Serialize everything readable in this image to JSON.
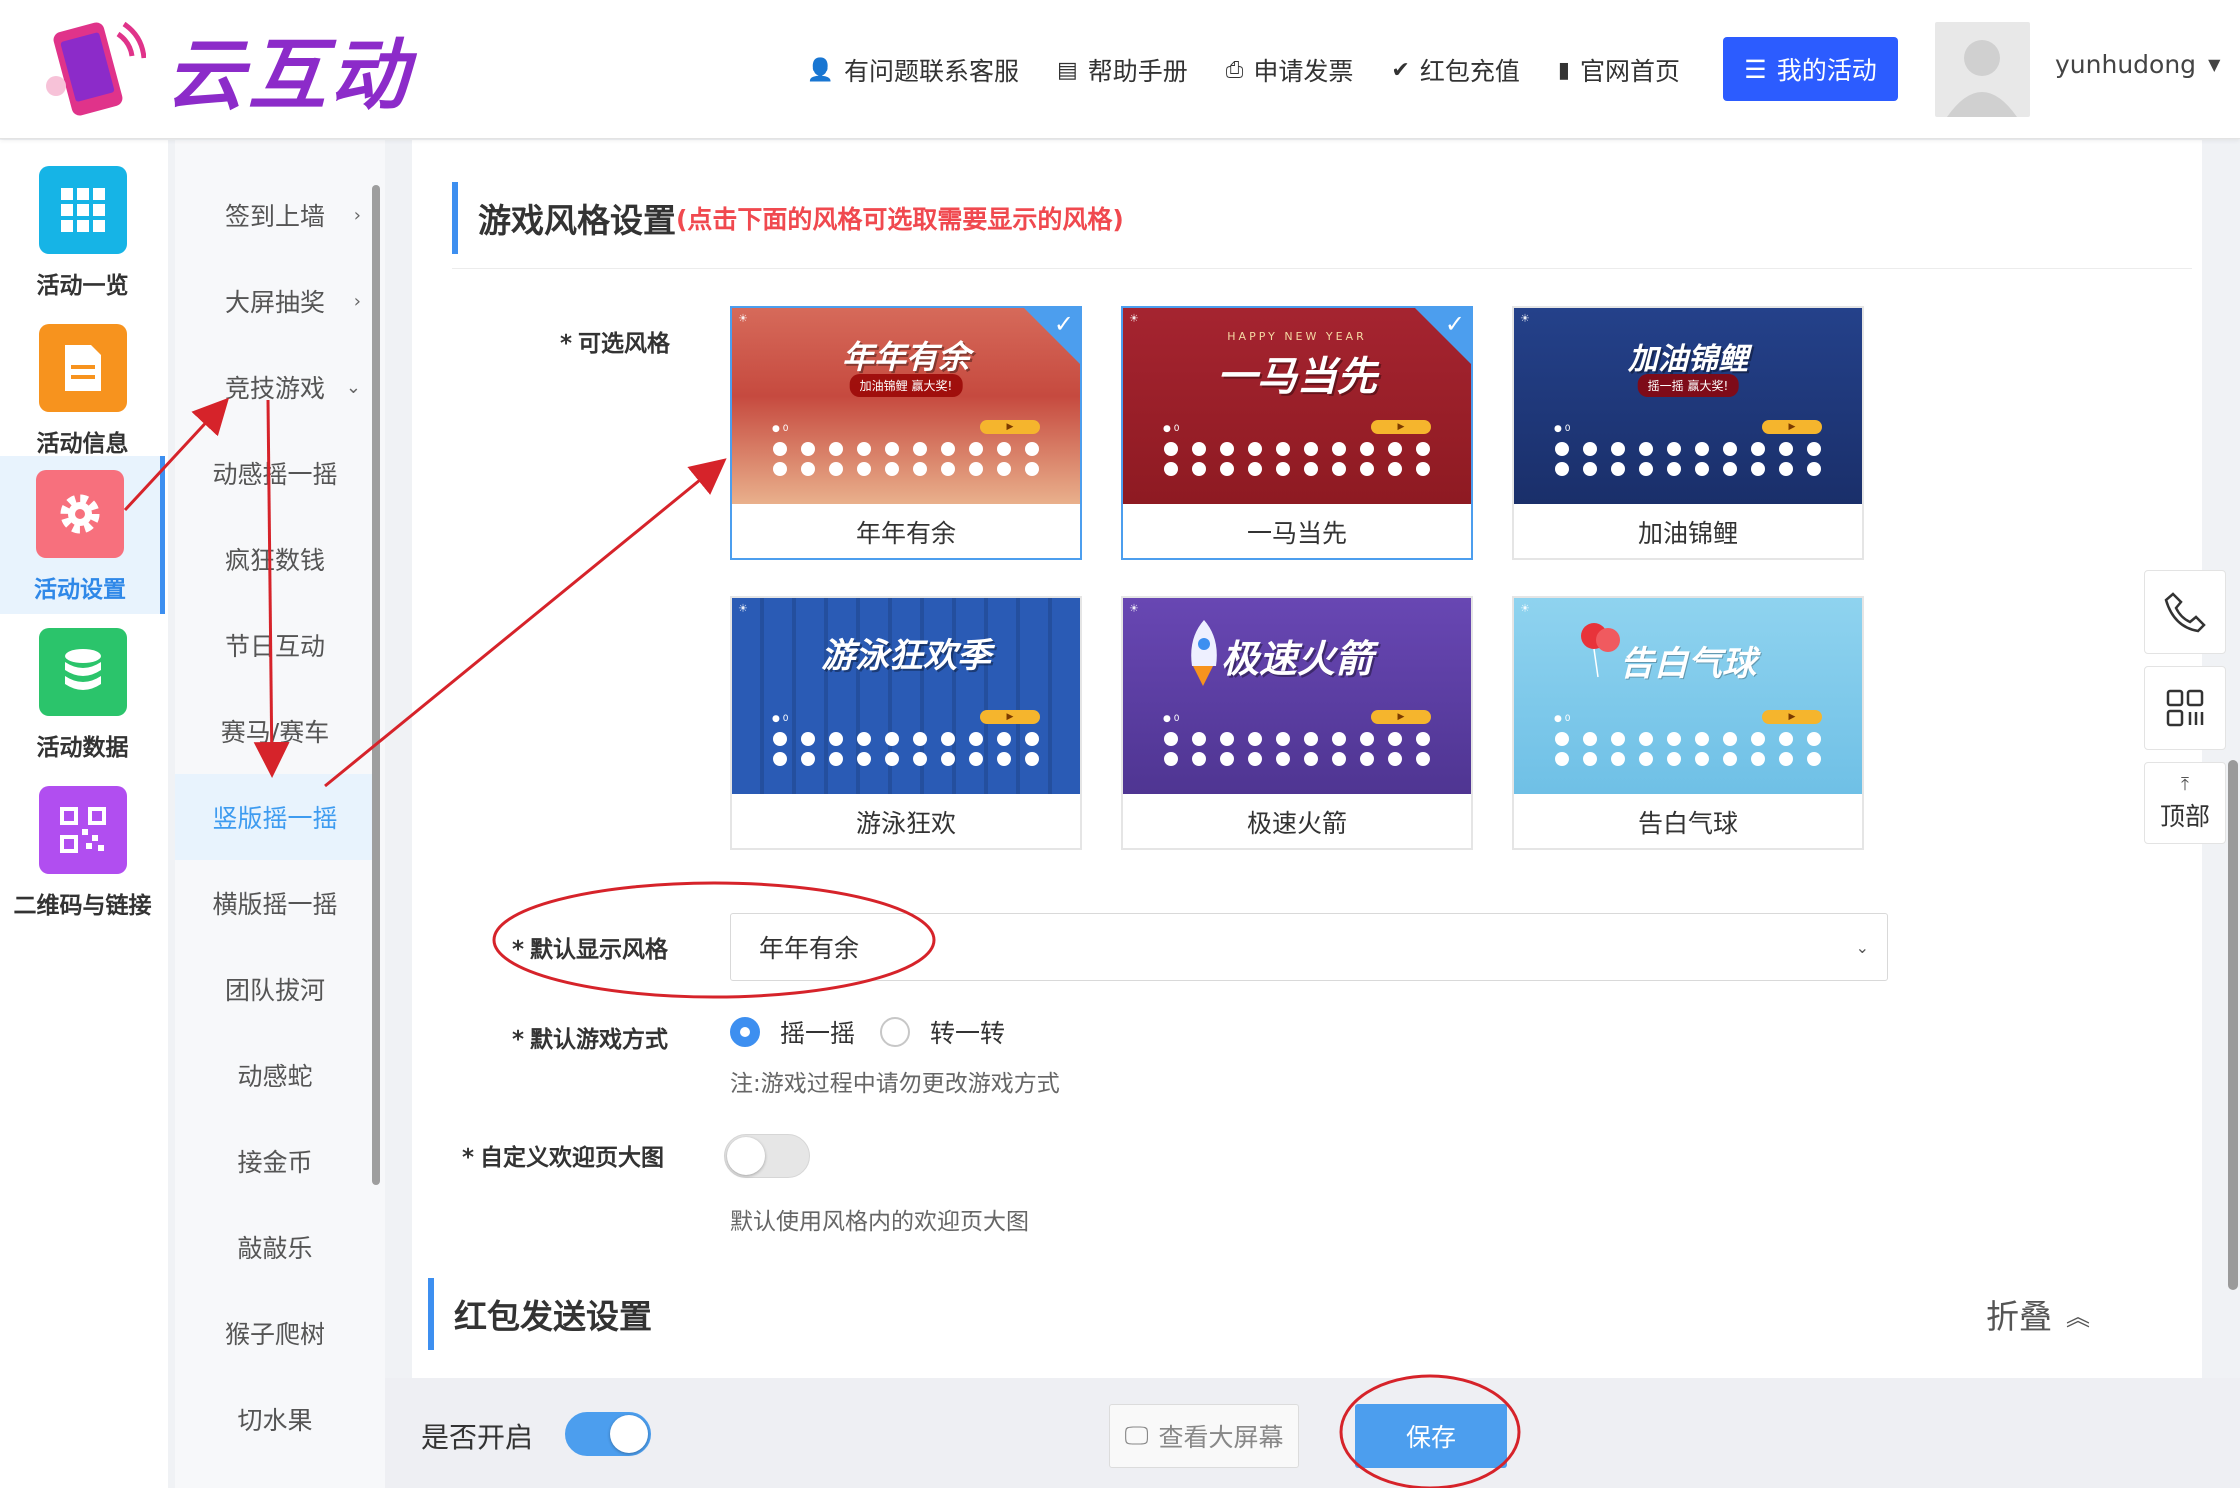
{
  "header": {
    "logo_text": "云互动",
    "nav": [
      {
        "label": "有问题联系客服",
        "icon": "add-user-icon"
      },
      {
        "label": "帮助手册",
        "icon": "book-icon"
      },
      {
        "label": "申请发票",
        "icon": "printer-icon"
      },
      {
        "label": "红包充值",
        "icon": "shield-check-icon"
      },
      {
        "label": "官网首页",
        "icon": "file-icon"
      }
    ],
    "my_activity_label": "我的活动",
    "username": "yunhudong",
    "colors": {
      "primary": "#2c5cff",
      "logo": "#8c2bc9"
    }
  },
  "sidebar": {
    "items": [
      {
        "label": "活动一览",
        "icon": "grid-icon",
        "color": "#16b4e6"
      },
      {
        "label": "活动信息",
        "icon": "document-icon",
        "color": "#f7931e"
      },
      {
        "label": "活动设置",
        "icon": "gear-icon",
        "color": "#f7707d",
        "active": true
      },
      {
        "label": "活动数据",
        "icon": "database-icon",
        "color": "#2bc46b"
      },
      {
        "label": "二维码与链接",
        "icon": "qrcode-icon",
        "color": "#b14ef0"
      }
    ]
  },
  "subnav": {
    "items": [
      {
        "label": "签到上墙",
        "chevron": "›"
      },
      {
        "label": "大屏抽奖",
        "chevron": "›"
      },
      {
        "label": "竞技游戏",
        "chevron": "⌄"
      },
      {
        "label": "动感摇一摇"
      },
      {
        "label": "疯狂数钱"
      },
      {
        "label": "节日互动"
      },
      {
        "label": "赛马/赛车"
      },
      {
        "label": "竖版摇一摇",
        "active": true
      },
      {
        "label": "横版摇一摇"
      },
      {
        "label": "团队拔河"
      },
      {
        "label": "动感蛇"
      },
      {
        "label": "接金币"
      },
      {
        "label": "敲敲乐"
      },
      {
        "label": "猴子爬树"
      },
      {
        "label": "切水果"
      }
    ]
  },
  "game_style": {
    "title": "游戏风格设置",
    "hint": "(点击下面的风格可选取需要显示的风格)",
    "available_label": "可选风格",
    "styles": [
      {
        "name": "年年有余",
        "banner": "年年有余",
        "sub": "加油锦鲤 赢大奖!",
        "bg": "#c64a3f",
        "selected": true
      },
      {
        "name": "一马当先",
        "banner": "一马当先",
        "sub": "HAPPY NEW YEAR",
        "bg": "#9c1d25",
        "selected": true
      },
      {
        "name": "加油锦鲤",
        "banner": "加油锦鲤",
        "sub": "摇一摇 赢大奖!",
        "bg": "#1e3778",
        "selected": false
      },
      {
        "name": "游泳狂欢",
        "banner": "游泳狂欢季",
        "sub": "",
        "bg": "#2553a8",
        "selected": false
      },
      {
        "name": "极速火箭",
        "banner": "极速火箭",
        "sub": "",
        "bg": "#5b3fa4",
        "selected": false
      },
      {
        "name": "告白气球",
        "banner": "告白气球",
        "sub": "",
        "bg": "#7ccbea",
        "selected": false
      }
    ],
    "default_style_label": "默认显示风格",
    "default_style_value": "年年有余",
    "default_mode_label": "默认游戏方式",
    "modes": [
      {
        "label": "摇一摇",
        "checked": true
      },
      {
        "label": "转一转",
        "checked": false
      }
    ],
    "mode_note": "注:游戏过程中请勿更改游戏方式",
    "welcome_label": "自定义欢迎页大图",
    "welcome_note": "默认使用风格内的欢迎页大图"
  },
  "red_packet": {
    "title": "红包发送设置",
    "fold_label": "折叠"
  },
  "bottom_bar": {
    "enable_label": "是否开启",
    "view_label": "查看大屏幕",
    "save_label": "保存"
  },
  "float_tools": {
    "top_label": "顶部"
  }
}
